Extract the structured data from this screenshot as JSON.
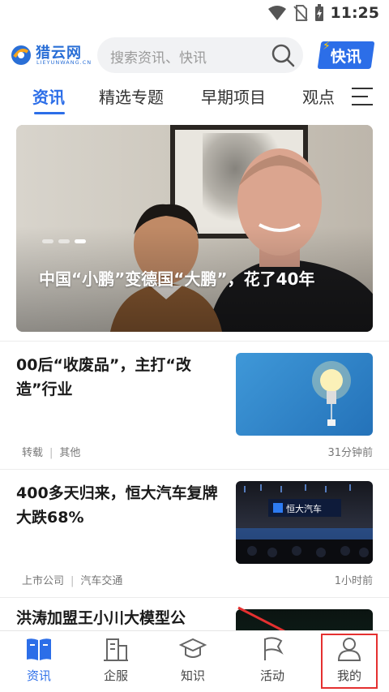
{
  "status_bar": {
    "time": "11:25"
  },
  "header": {
    "logo_text": "猎云网",
    "logo_sub": "LIEYUNWANG.CN",
    "search_placeholder": "搜索资讯、快讯",
    "kuaixun_label": "快讯"
  },
  "tabs": [
    {
      "label": "资讯",
      "active": true
    },
    {
      "label": "精选专题",
      "active": false
    },
    {
      "label": "早期项目",
      "active": false
    },
    {
      "label": "观点",
      "active": false
    }
  ],
  "banner": {
    "title": "中国“小鹏”变德国“大鹏”，花了40年",
    "dots": 3,
    "active_dot": 3
  },
  "news": [
    {
      "title": "00后“收废品”，主打“改造”行业",
      "tags": [
        "转载",
        "其他"
      ],
      "time": "31分钟前",
      "thumb": "lightbulb"
    },
    {
      "title": "400多天归来，恒大汽车复牌大跌68%",
      "tags": [
        "上市公司",
        "汽车交通"
      ],
      "time": "1小时前",
      "thumb": "evergrande-auto-stage",
      "thumb_sign": "恒大汽车"
    },
    {
      "title": "洪涛加盟王小川大模型公",
      "tags": [],
      "time": "",
      "thumb": "dark-data"
    }
  ],
  "bottom_nav": [
    {
      "label": "资讯",
      "icon": "book-icon",
      "active": true
    },
    {
      "label": "企服",
      "icon": "building-icon",
      "active": false
    },
    {
      "label": "知识",
      "icon": "graduation-cap-icon",
      "active": false
    },
    {
      "label": "活动",
      "icon": "flag-icon",
      "active": false
    },
    {
      "label": "我的",
      "icon": "user-icon",
      "active": false
    }
  ],
  "colors": {
    "accent": "#2c6ee8",
    "highlight": "#e53030"
  }
}
